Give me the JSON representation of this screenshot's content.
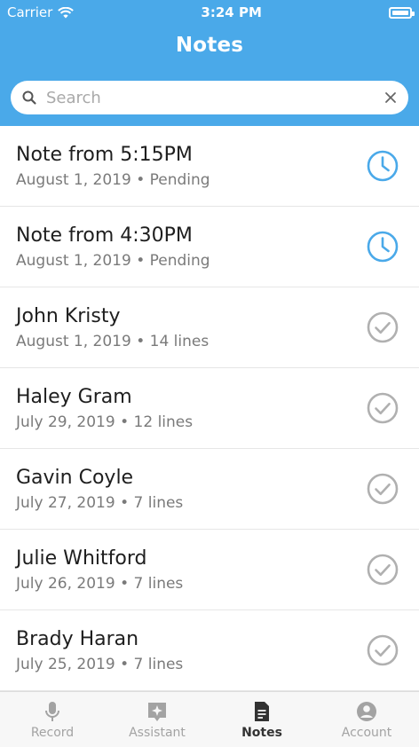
{
  "status_bar": {
    "carrier": "Carrier",
    "time": "3:24 PM"
  },
  "header": {
    "title": "Notes"
  },
  "search": {
    "placeholder": "Search",
    "value": ""
  },
  "notes": [
    {
      "title": "Note from 5:15PM",
      "date": "August 1, 2019",
      "detail": "Pending",
      "status": "pending"
    },
    {
      "title": "Note from 4:30PM",
      "date": "August 1, 2019",
      "detail": "Pending",
      "status": "pending"
    },
    {
      "title": "John Kristy",
      "date": "August 1, 2019",
      "detail": "14 lines",
      "status": "done"
    },
    {
      "title": "Haley Gram",
      "date": "July 29, 2019",
      "detail": "12 lines",
      "status": "done"
    },
    {
      "title": "Gavin Coyle",
      "date": "July 27, 2019",
      "detail": "7 lines",
      "status": "done"
    },
    {
      "title": "Julie Whitford",
      "date": "July 26, 2019",
      "detail": "7 lines",
      "status": "done"
    },
    {
      "title": "Brady Haran",
      "date": "July 25, 2019",
      "detail": "7 lines",
      "status": "done"
    }
  ],
  "tabs": [
    {
      "label": "Record",
      "icon": "microphone-icon",
      "active": false
    },
    {
      "label": "Assistant",
      "icon": "sparkle-icon",
      "active": false
    },
    {
      "label": "Notes",
      "icon": "document-icon",
      "active": true
    },
    {
      "label": "Account",
      "icon": "person-icon",
      "active": false
    }
  ],
  "colors": {
    "accent": "#4aa9e9",
    "done_icon": "#b0b0b0",
    "text": "#1e1e1e",
    "subtext": "#7a7a7a"
  }
}
